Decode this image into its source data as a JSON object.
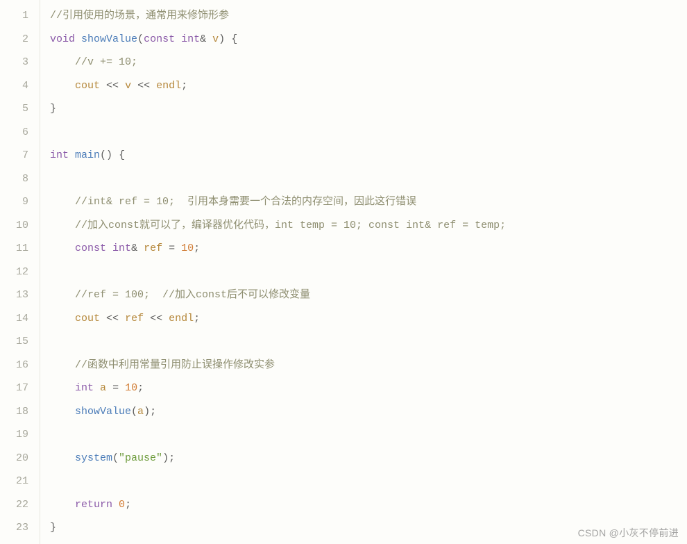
{
  "watermark": "CSDN @小灰不停前进",
  "code": {
    "line_count": 23,
    "lines": [
      [
        {
          "cls": "tk-comment",
          "t": "//引用使用的场景，通常用来修饰形参"
        }
      ],
      [
        {
          "cls": "tk-keyword",
          "t": "void"
        },
        {
          "cls": "",
          "t": " "
        },
        {
          "cls": "tk-func",
          "t": "showValue"
        },
        {
          "cls": "tk-punct",
          "t": "("
        },
        {
          "cls": "tk-keyword",
          "t": "const"
        },
        {
          "cls": "",
          "t": " "
        },
        {
          "cls": "tk-keyword",
          "t": "int"
        },
        {
          "cls": "tk-punct",
          "t": "&"
        },
        {
          "cls": "",
          "t": " "
        },
        {
          "cls": "tk-ident",
          "t": "v"
        },
        {
          "cls": "tk-punct",
          "t": ")"
        },
        {
          "cls": "",
          "t": " "
        },
        {
          "cls": "tk-punct",
          "t": "{"
        }
      ],
      [
        {
          "cls": "",
          "t": "    "
        },
        {
          "cls": "tk-comment",
          "t": "//v += 10;"
        }
      ],
      [
        {
          "cls": "",
          "t": "    "
        },
        {
          "cls": "tk-ident",
          "t": "cout"
        },
        {
          "cls": "",
          "t": " "
        },
        {
          "cls": "tk-op",
          "t": "<<"
        },
        {
          "cls": "",
          "t": " "
        },
        {
          "cls": "tk-ident",
          "t": "v"
        },
        {
          "cls": "",
          "t": " "
        },
        {
          "cls": "tk-op",
          "t": "<<"
        },
        {
          "cls": "",
          "t": " "
        },
        {
          "cls": "tk-ident",
          "t": "endl"
        },
        {
          "cls": "tk-punct",
          "t": ";"
        }
      ],
      [
        {
          "cls": "tk-punct",
          "t": "}"
        }
      ],
      [
        {
          "cls": "",
          "t": ""
        }
      ],
      [
        {
          "cls": "tk-keyword",
          "t": "int"
        },
        {
          "cls": "",
          "t": " "
        },
        {
          "cls": "tk-func",
          "t": "main"
        },
        {
          "cls": "tk-punct",
          "t": "()"
        },
        {
          "cls": "",
          "t": " "
        },
        {
          "cls": "tk-punct",
          "t": "{"
        }
      ],
      [
        {
          "cls": "",
          "t": ""
        }
      ],
      [
        {
          "cls": "",
          "t": "    "
        },
        {
          "cls": "tk-comment",
          "t": "//int& ref = 10;  引用本身需要一个合法的内存空间，因此这行错误"
        }
      ],
      [
        {
          "cls": "",
          "t": "    "
        },
        {
          "cls": "tk-comment",
          "t": "//加入const就可以了，编译器优化代码，int temp = 10; const int& ref = temp;"
        }
      ],
      [
        {
          "cls": "",
          "t": "    "
        },
        {
          "cls": "tk-keyword",
          "t": "const"
        },
        {
          "cls": "",
          "t": " "
        },
        {
          "cls": "tk-keyword",
          "t": "int"
        },
        {
          "cls": "tk-punct",
          "t": "&"
        },
        {
          "cls": "",
          "t": " "
        },
        {
          "cls": "tk-ident",
          "t": "ref"
        },
        {
          "cls": "",
          "t": " "
        },
        {
          "cls": "tk-op",
          "t": "="
        },
        {
          "cls": "",
          "t": " "
        },
        {
          "cls": "tk-number",
          "t": "10"
        },
        {
          "cls": "tk-punct",
          "t": ";"
        }
      ],
      [
        {
          "cls": "",
          "t": ""
        }
      ],
      [
        {
          "cls": "",
          "t": "    "
        },
        {
          "cls": "tk-comment",
          "t": "//ref = 100;  //加入const后不可以修改变量"
        }
      ],
      [
        {
          "cls": "",
          "t": "    "
        },
        {
          "cls": "tk-ident",
          "t": "cout"
        },
        {
          "cls": "",
          "t": " "
        },
        {
          "cls": "tk-op",
          "t": "<<"
        },
        {
          "cls": "",
          "t": " "
        },
        {
          "cls": "tk-ident",
          "t": "ref"
        },
        {
          "cls": "",
          "t": " "
        },
        {
          "cls": "tk-op",
          "t": "<<"
        },
        {
          "cls": "",
          "t": " "
        },
        {
          "cls": "tk-ident",
          "t": "endl"
        },
        {
          "cls": "tk-punct",
          "t": ";"
        }
      ],
      [
        {
          "cls": "",
          "t": ""
        }
      ],
      [
        {
          "cls": "",
          "t": "    "
        },
        {
          "cls": "tk-comment",
          "t": "//函数中利用常量引用防止误操作修改实参"
        }
      ],
      [
        {
          "cls": "",
          "t": "    "
        },
        {
          "cls": "tk-keyword",
          "t": "int"
        },
        {
          "cls": "",
          "t": " "
        },
        {
          "cls": "tk-ident",
          "t": "a"
        },
        {
          "cls": "",
          "t": " "
        },
        {
          "cls": "tk-op",
          "t": "="
        },
        {
          "cls": "",
          "t": " "
        },
        {
          "cls": "tk-number",
          "t": "10"
        },
        {
          "cls": "tk-punct",
          "t": ";"
        }
      ],
      [
        {
          "cls": "",
          "t": "    "
        },
        {
          "cls": "tk-func",
          "t": "showValue"
        },
        {
          "cls": "tk-punct",
          "t": "("
        },
        {
          "cls": "tk-ident",
          "t": "a"
        },
        {
          "cls": "tk-punct",
          "t": ")"
        },
        {
          "cls": "tk-punct",
          "t": ";"
        }
      ],
      [
        {
          "cls": "",
          "t": ""
        }
      ],
      [
        {
          "cls": "",
          "t": "    "
        },
        {
          "cls": "tk-func",
          "t": "system"
        },
        {
          "cls": "tk-punct",
          "t": "("
        },
        {
          "cls": "tk-string",
          "t": "\"pause\""
        },
        {
          "cls": "tk-punct",
          "t": ")"
        },
        {
          "cls": "tk-punct",
          "t": ";"
        }
      ],
      [
        {
          "cls": "",
          "t": ""
        }
      ],
      [
        {
          "cls": "",
          "t": "    "
        },
        {
          "cls": "tk-keyword",
          "t": "return"
        },
        {
          "cls": "",
          "t": " "
        },
        {
          "cls": "tk-number",
          "t": "0"
        },
        {
          "cls": "tk-punct",
          "t": ";"
        }
      ],
      [
        {
          "cls": "tk-punct",
          "t": "}"
        }
      ]
    ]
  }
}
